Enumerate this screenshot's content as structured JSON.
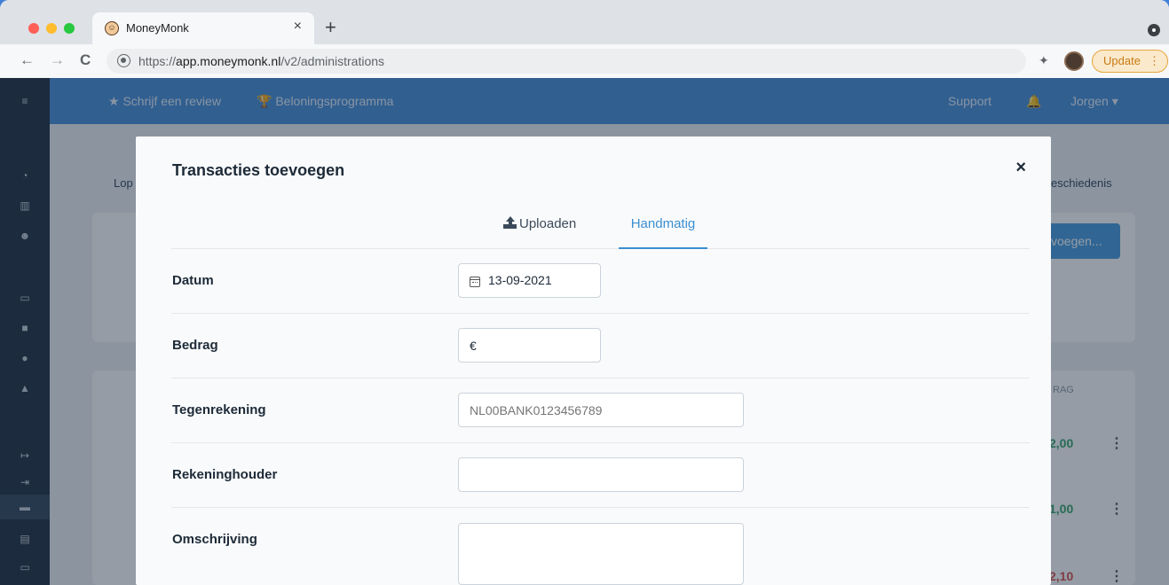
{
  "browser": {
    "tab_title": "MoneyMonk",
    "tab_close": "×",
    "new_tab": "+",
    "url_prefix": "https://",
    "url_domain": "app.moneymonk.nl",
    "url_path": "/v2/administrations",
    "update_label": "Update",
    "update_menu": "⋮",
    "back": "←",
    "forward": "→",
    "reload": "C"
  },
  "app": {
    "topbar": {
      "review": "★ Schrijf een review",
      "rewards": "🏆 Beloningsprogramma",
      "support": "Support",
      "user": "Jorgen ▾"
    },
    "bg_tab_left": "Lop",
    "bg_tab_right": "eschiedenis",
    "bg_button": "voegen...",
    "bg_column": "RAG",
    "amounts": [
      {
        "text": "2,00",
        "color": "#3aa76d"
      },
      {
        "text": "1,00",
        "color": "#3aa76d"
      },
      {
        "text": "2,10",
        "color": "#d9534f"
      }
    ]
  },
  "modal": {
    "title": "Transacties toevoegen",
    "close": "×",
    "tabs": {
      "upload": "Uploaden",
      "manual": "Handmatig"
    },
    "fields": {
      "date": {
        "label": "Datum",
        "value": "13-09-2021"
      },
      "amount": {
        "label": "Bedrag",
        "prefix": "€",
        "value": ""
      },
      "counter_account": {
        "label": "Tegenrekening",
        "placeholder": "NL00BANK0123456789"
      },
      "account_holder": {
        "label": "Rekeninghouder",
        "value": ""
      },
      "description": {
        "label": "Omschrijving",
        "value": ""
      }
    }
  },
  "colors": {
    "accent": "#3a8fd1",
    "topbar": "#4a90d9",
    "sidebar": "#233243"
  }
}
